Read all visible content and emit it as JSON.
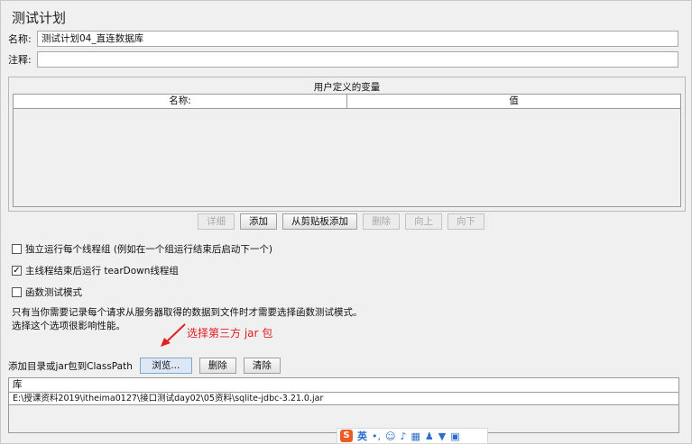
{
  "panel": {
    "title": "测试计划"
  },
  "fields": {
    "name_label": "名称:",
    "name_value": "测试计划04_直连数据库",
    "comment_label": "注释:",
    "comment_value": ""
  },
  "variables": {
    "caption": "用户定义的变量",
    "columns": [
      "名称:",
      "值"
    ],
    "buttons": {
      "detail": "详细",
      "add": "添加",
      "add_from_clipboard": "从剪贴板添加",
      "delete": "删除",
      "up": "向上",
      "down": "向下"
    }
  },
  "options": {
    "independent_threads": {
      "label": "独立运行每个线程组 (例如在一个组运行结束后启动下一个)",
      "checked": false
    },
    "teardown": {
      "label": "主线程结束后运行 tearDown线程组",
      "checked": true
    },
    "functional_mode": {
      "label": "函数测试模式",
      "checked": false
    }
  },
  "notes": {
    "line1": "只有当你需要记录每个请求从服务器取得的数据到文件时才需要选择函数测试模式。",
    "line2": "选择这个选项很影响性能。"
  },
  "annotation": {
    "text": "选择第三方 jar 包",
    "color": "#e02020"
  },
  "classpath": {
    "label": "添加目录或jar包到ClassPath",
    "browse": "浏览...",
    "delete": "删除",
    "clear": "清除"
  },
  "library": {
    "header": "库",
    "rows": [
      "E:\\授课资料2019\\itheima0127\\接口测试day02\\05资料\\sqlite-jdbc-3.21.0.jar"
    ]
  },
  "ime": {
    "lang": "英"
  }
}
